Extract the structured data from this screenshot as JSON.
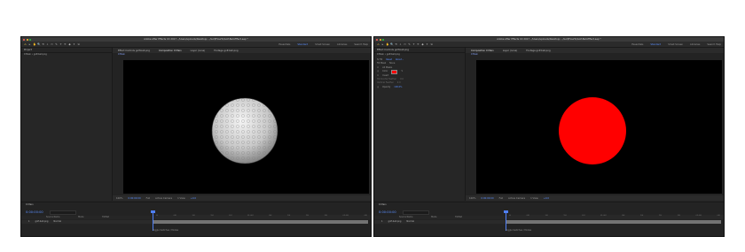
{
  "left_window": {
    "title": "Adobe After Effects CC 2017 - /Users/uploads/Desktop/...  /Golf/HowTo/Golf-Ball-Effect.aep *",
    "tools": [
      "▸",
      "✋",
      "🔍",
      "⟲",
      "⌖",
      "▭",
      "✎",
      "T",
      "✒",
      "◆",
      "✦",
      "⇲"
    ],
    "workspaces": [
      "Essentials",
      "Standard",
      "Small Screen",
      "Libraries"
    ],
    "active_workspace": "Standard",
    "search_label": "Search Help",
    "project_tab": "Project",
    "project_sub": "0 Main • golf-ball.png",
    "viewer_tabs": [
      "Effect Controls golf-ball.png",
      "Composition 0 Main",
      "Layer (none)",
      "Footage golf-ball.png"
    ],
    "viewer_subtab": "0 Main",
    "viewer_controls": [
      "100%",
      "0:00:00:00",
      "Full",
      "Active Camera",
      "1 View",
      "+0.0"
    ],
    "timeline_tab": "0 Main",
    "timecode": "0:00:00:00",
    "tl_columns": [
      "Source Name",
      "Mode",
      "TrkMat"
    ],
    "tl_layer": {
      "index": "1",
      "name": "golf-ball.png",
      "mode": "Normal"
    },
    "ruler": [
      "0f",
      "05f",
      "10f",
      "15f",
      "20f",
      "01:00f",
      "05f",
      "10f",
      "15f",
      "20f",
      "02:00f",
      "05f"
    ],
    "footer": "Toggle Switches / Modes",
    "ball_label": "golf ball"
  },
  "right_window": {
    "title": "Adobe After Effects CC 2017 - /Users/uploads/Desktop/... /Golf/HowTo/Golf-Ball-Effect.aep *",
    "tools": [
      "▸",
      "✋",
      "🔍",
      "⟲",
      "⌖",
      "▭",
      "✎",
      "T",
      "✒",
      "◆",
      "✦",
      "⇲"
    ],
    "workspaces": [
      "Essentials",
      "Standard",
      "Small Screen",
      "Libraries"
    ],
    "active_workspace": "Standard",
    "search_label": "Search Help",
    "project_tab": "Effect Controls golf-ball.png",
    "project_sub": "0 Main • golf-ball.png",
    "effect_rows": [
      {
        "label": "fx Fill",
        "value": "Reset",
        "extra": "About..."
      },
      {
        "label": "Fill Mask",
        "value": "None",
        "extra": ""
      },
      {
        "label": "All Masks",
        "value": "",
        "extra": ""
      },
      {
        "label": "Color",
        "value": "",
        "extra": ""
      },
      {
        "label": "Invert",
        "value": "",
        "extra": ""
      },
      {
        "label": "Horizontal Feather",
        "value": "0.0",
        "extra": ""
      },
      {
        "label": "Vertical Feather",
        "value": "0.0",
        "extra": ""
      },
      {
        "label": "Opacity",
        "value": "100.0%",
        "extra": ""
      }
    ],
    "fill_color": "#ff0000",
    "viewer_tabs": [
      "Composition 0 Main",
      "Layer (none)",
      "Footage golf-ball.png"
    ],
    "viewer_subtab": "0 Main",
    "viewer_controls": [
      "100%",
      "0:00:00:00",
      "Full",
      "Active Camera",
      "1 View",
      "+0.0"
    ],
    "timeline_tab": "0 Main",
    "timecode": "0:00:00:00",
    "tl_columns": [
      "Source Name",
      "Mode",
      "TrkMat"
    ],
    "tl_layer": {
      "index": "1",
      "name": "golf-ball.png",
      "mode": "Normal"
    },
    "ruler": [
      "0f",
      "05f",
      "10f",
      "15f",
      "20f",
      "01:00f",
      "05f",
      "10f",
      "15f",
      "20f",
      "02:00f",
      "05f"
    ],
    "footer": "Toggle Switches / Modes"
  }
}
